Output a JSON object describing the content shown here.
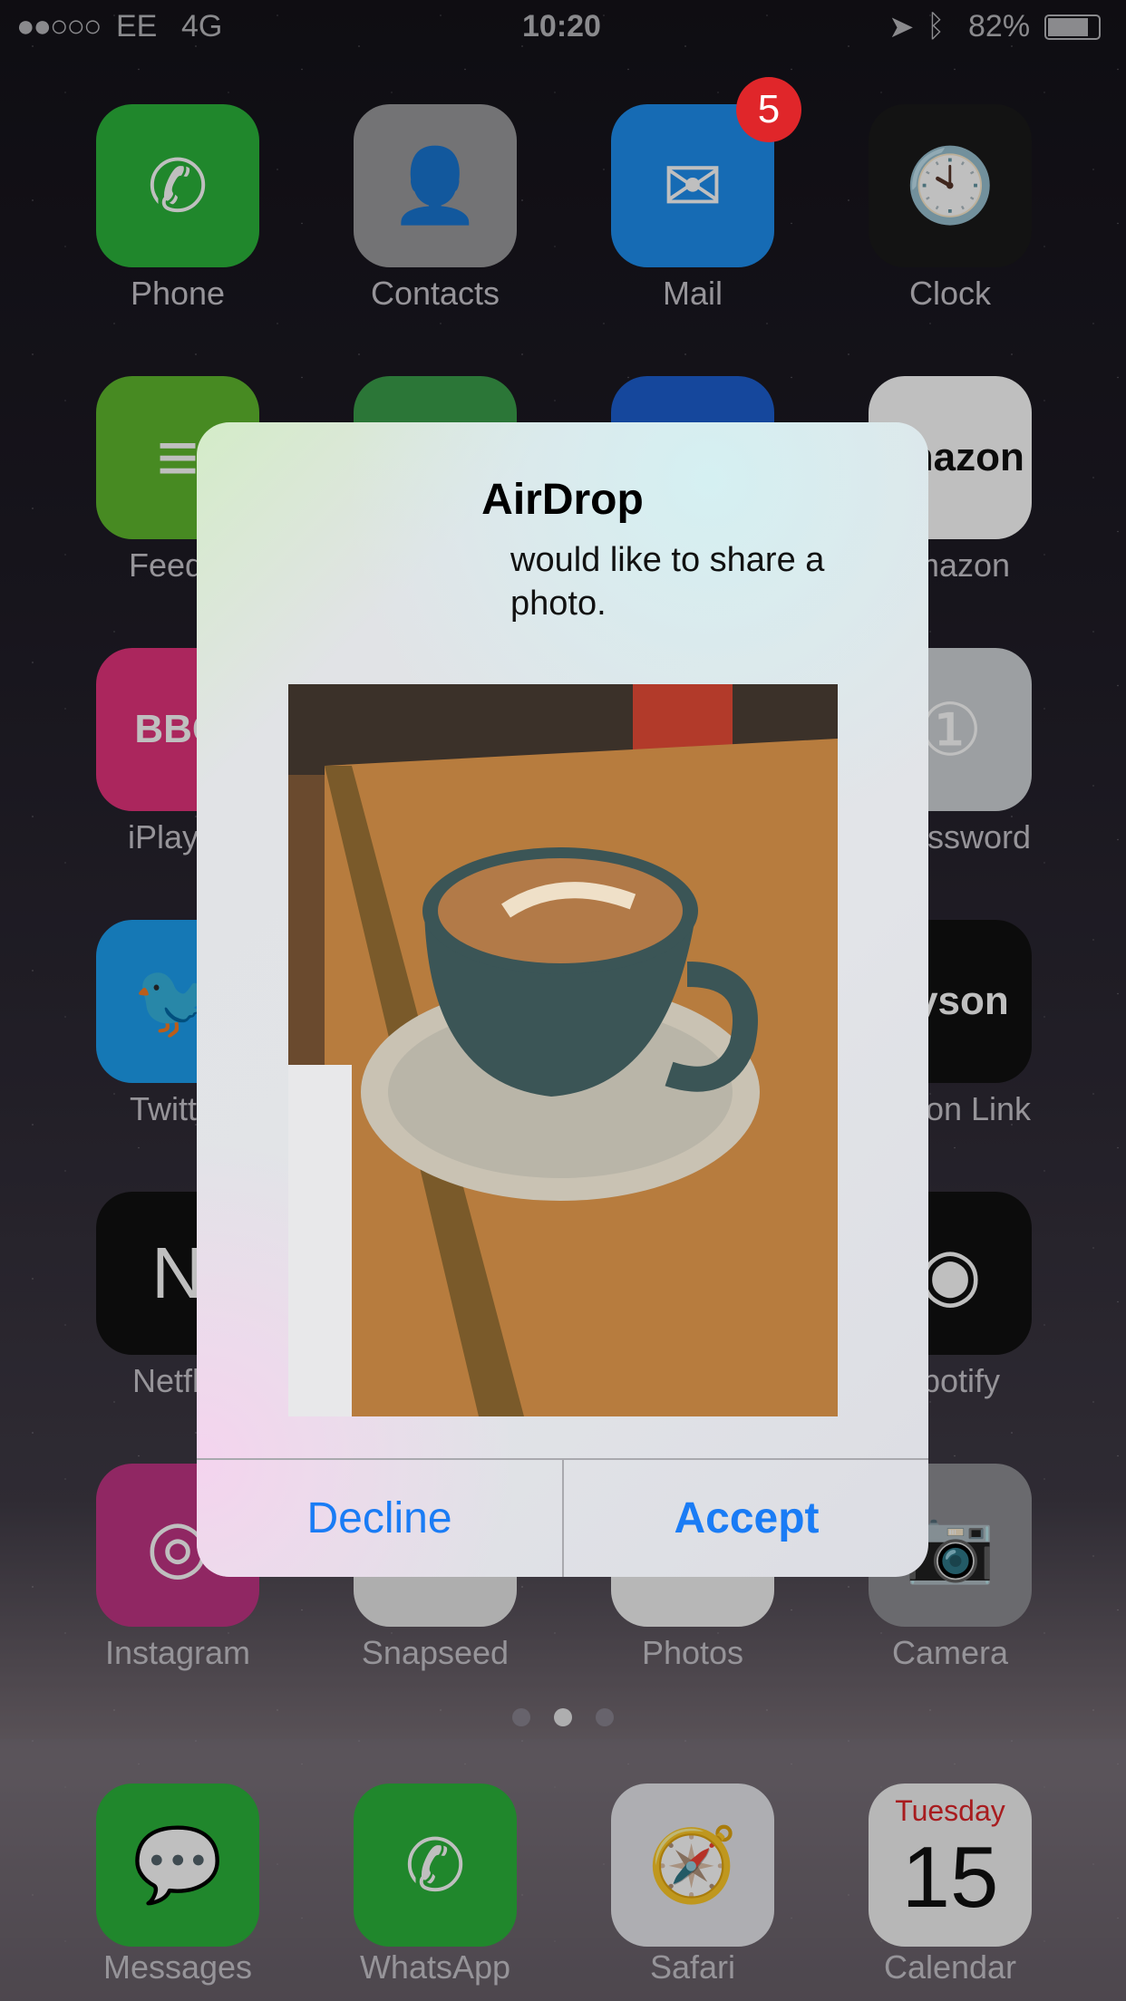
{
  "status": {
    "signal_strength": "2 of 5",
    "carrier": "EE",
    "network": "4G",
    "time": "10:20",
    "battery": "82%",
    "location_icon": "location-arrow-icon",
    "bluetooth_icon": "bluetooth-icon"
  },
  "apps": [
    {
      "label": "Phone",
      "color": "#2bb43b",
      "glyph": "✆"
    },
    {
      "label": "Contacts",
      "color": "#9a9a9c",
      "glyph": "👤"
    },
    {
      "label": "Mail",
      "color": "#1e8ff0",
      "glyph": "✉",
      "badge": "5"
    },
    {
      "label": "Clock",
      "color": "#1a1a1a",
      "glyph": "🕙"
    },
    {
      "label": "Feedly",
      "color": "#5fb92e",
      "glyph": "≡"
    },
    {
      "label": "",
      "color": "#3a9e4a",
      "glyph": "G"
    },
    {
      "label": "",
      "color": "#1c5fd0",
      "glyph": ""
    },
    {
      "label": "Amazon",
      "color": "#ffffff",
      "glyph": "amazon"
    },
    {
      "label": "iPlayer",
      "color": "#e5337d",
      "glyph": "BBC"
    },
    {
      "label": "",
      "color": "#555",
      "glyph": ""
    },
    {
      "label": "",
      "color": "#555",
      "glyph": ""
    },
    {
      "label": "1Password",
      "color": "#d0d4d8",
      "glyph": "①"
    },
    {
      "label": "Twitter",
      "color": "#1da1f2",
      "glyph": "🐦"
    },
    {
      "label": "",
      "color": "#555",
      "glyph": ""
    },
    {
      "label": "",
      "color": "#555",
      "glyph": ""
    },
    {
      "label": "Dyson Link",
      "color": "#111",
      "glyph": "dyson"
    },
    {
      "label": "Netflix",
      "color": "#111",
      "glyph": "N"
    },
    {
      "label": "",
      "color": "#555",
      "glyph": ""
    },
    {
      "label": "",
      "color": "#555",
      "glyph": ""
    },
    {
      "label": "Spotify",
      "color": "#111",
      "glyph": "◉"
    },
    {
      "label": "Instagram",
      "color": "#c13584",
      "glyph": "◎"
    },
    {
      "label": "Snapseed",
      "color": "#e8e8e8",
      "glyph": ""
    },
    {
      "label": "Photos",
      "color": "#f4f4f4",
      "glyph": "✿"
    },
    {
      "label": "Camera",
      "color": "#8e8e93",
      "glyph": "📷"
    }
  ],
  "page_dots": {
    "count": 3,
    "active": 2
  },
  "dock": [
    {
      "label": "Messages",
      "color": "#2bb43b",
      "glyph": "💬"
    },
    {
      "label": "WhatsApp",
      "color": "#2bb43b",
      "glyph": "✆"
    },
    {
      "label": "Safari",
      "color": "#e9e9ee",
      "glyph": "🧭"
    },
    {
      "label": "Calendar",
      "color": "#f4f4f4",
      "day": "Tuesday",
      "date": "15"
    }
  ],
  "dialog": {
    "title": "AirDrop",
    "message": "would like to share a photo.",
    "decline": "Decline",
    "accept": "Accept",
    "accent": "#1a7cf5"
  }
}
